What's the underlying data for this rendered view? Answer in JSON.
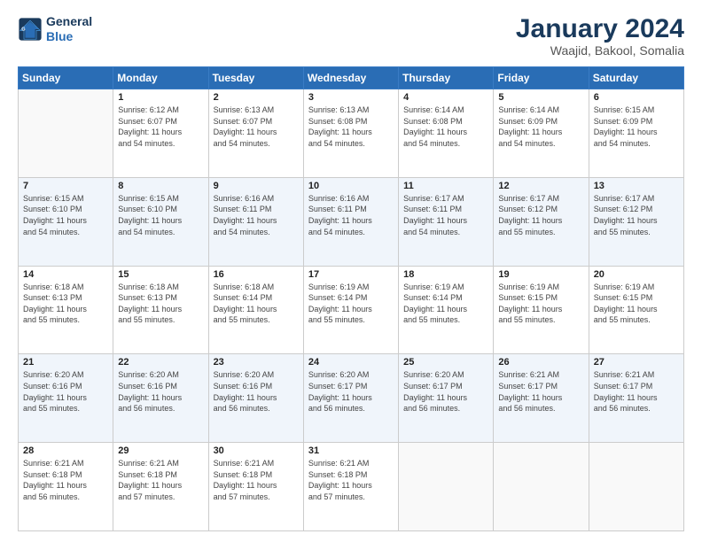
{
  "header": {
    "logo_line1": "General",
    "logo_line2": "Blue",
    "title": "January 2024",
    "subtitle": "Waajid, Bakool, Somalia"
  },
  "days_of_week": [
    "Sunday",
    "Monday",
    "Tuesday",
    "Wednesday",
    "Thursday",
    "Friday",
    "Saturday"
  ],
  "weeks": [
    [
      {
        "day": "",
        "info": ""
      },
      {
        "day": "1",
        "info": "Sunrise: 6:12 AM\nSunset: 6:07 PM\nDaylight: 11 hours\nand 54 minutes."
      },
      {
        "day": "2",
        "info": "Sunrise: 6:13 AM\nSunset: 6:07 PM\nDaylight: 11 hours\nand 54 minutes."
      },
      {
        "day": "3",
        "info": "Sunrise: 6:13 AM\nSunset: 6:08 PM\nDaylight: 11 hours\nand 54 minutes."
      },
      {
        "day": "4",
        "info": "Sunrise: 6:14 AM\nSunset: 6:08 PM\nDaylight: 11 hours\nand 54 minutes."
      },
      {
        "day": "5",
        "info": "Sunrise: 6:14 AM\nSunset: 6:09 PM\nDaylight: 11 hours\nand 54 minutes."
      },
      {
        "day": "6",
        "info": "Sunrise: 6:15 AM\nSunset: 6:09 PM\nDaylight: 11 hours\nand 54 minutes."
      }
    ],
    [
      {
        "day": "7",
        "info": "Sunrise: 6:15 AM\nSunset: 6:10 PM\nDaylight: 11 hours\nand 54 minutes."
      },
      {
        "day": "8",
        "info": "Sunrise: 6:15 AM\nSunset: 6:10 PM\nDaylight: 11 hours\nand 54 minutes."
      },
      {
        "day": "9",
        "info": "Sunrise: 6:16 AM\nSunset: 6:11 PM\nDaylight: 11 hours\nand 54 minutes."
      },
      {
        "day": "10",
        "info": "Sunrise: 6:16 AM\nSunset: 6:11 PM\nDaylight: 11 hours\nand 54 minutes."
      },
      {
        "day": "11",
        "info": "Sunrise: 6:17 AM\nSunset: 6:11 PM\nDaylight: 11 hours\nand 54 minutes."
      },
      {
        "day": "12",
        "info": "Sunrise: 6:17 AM\nSunset: 6:12 PM\nDaylight: 11 hours\nand 55 minutes."
      },
      {
        "day": "13",
        "info": "Sunrise: 6:17 AM\nSunset: 6:12 PM\nDaylight: 11 hours\nand 55 minutes."
      }
    ],
    [
      {
        "day": "14",
        "info": "Sunrise: 6:18 AM\nSunset: 6:13 PM\nDaylight: 11 hours\nand 55 minutes."
      },
      {
        "day": "15",
        "info": "Sunrise: 6:18 AM\nSunset: 6:13 PM\nDaylight: 11 hours\nand 55 minutes."
      },
      {
        "day": "16",
        "info": "Sunrise: 6:18 AM\nSunset: 6:14 PM\nDaylight: 11 hours\nand 55 minutes."
      },
      {
        "day": "17",
        "info": "Sunrise: 6:19 AM\nSunset: 6:14 PM\nDaylight: 11 hours\nand 55 minutes."
      },
      {
        "day": "18",
        "info": "Sunrise: 6:19 AM\nSunset: 6:14 PM\nDaylight: 11 hours\nand 55 minutes."
      },
      {
        "day": "19",
        "info": "Sunrise: 6:19 AM\nSunset: 6:15 PM\nDaylight: 11 hours\nand 55 minutes."
      },
      {
        "day": "20",
        "info": "Sunrise: 6:19 AM\nSunset: 6:15 PM\nDaylight: 11 hours\nand 55 minutes."
      }
    ],
    [
      {
        "day": "21",
        "info": "Sunrise: 6:20 AM\nSunset: 6:16 PM\nDaylight: 11 hours\nand 55 minutes."
      },
      {
        "day": "22",
        "info": "Sunrise: 6:20 AM\nSunset: 6:16 PM\nDaylight: 11 hours\nand 56 minutes."
      },
      {
        "day": "23",
        "info": "Sunrise: 6:20 AM\nSunset: 6:16 PM\nDaylight: 11 hours\nand 56 minutes."
      },
      {
        "day": "24",
        "info": "Sunrise: 6:20 AM\nSunset: 6:17 PM\nDaylight: 11 hours\nand 56 minutes."
      },
      {
        "day": "25",
        "info": "Sunrise: 6:20 AM\nSunset: 6:17 PM\nDaylight: 11 hours\nand 56 minutes."
      },
      {
        "day": "26",
        "info": "Sunrise: 6:21 AM\nSunset: 6:17 PM\nDaylight: 11 hours\nand 56 minutes."
      },
      {
        "day": "27",
        "info": "Sunrise: 6:21 AM\nSunset: 6:17 PM\nDaylight: 11 hours\nand 56 minutes."
      }
    ],
    [
      {
        "day": "28",
        "info": "Sunrise: 6:21 AM\nSunset: 6:18 PM\nDaylight: 11 hours\nand 56 minutes."
      },
      {
        "day": "29",
        "info": "Sunrise: 6:21 AM\nSunset: 6:18 PM\nDaylight: 11 hours\nand 57 minutes."
      },
      {
        "day": "30",
        "info": "Sunrise: 6:21 AM\nSunset: 6:18 PM\nDaylight: 11 hours\nand 57 minutes."
      },
      {
        "day": "31",
        "info": "Sunrise: 6:21 AM\nSunset: 6:18 PM\nDaylight: 11 hours\nand 57 minutes."
      },
      {
        "day": "",
        "info": ""
      },
      {
        "day": "",
        "info": ""
      },
      {
        "day": "",
        "info": ""
      }
    ]
  ]
}
